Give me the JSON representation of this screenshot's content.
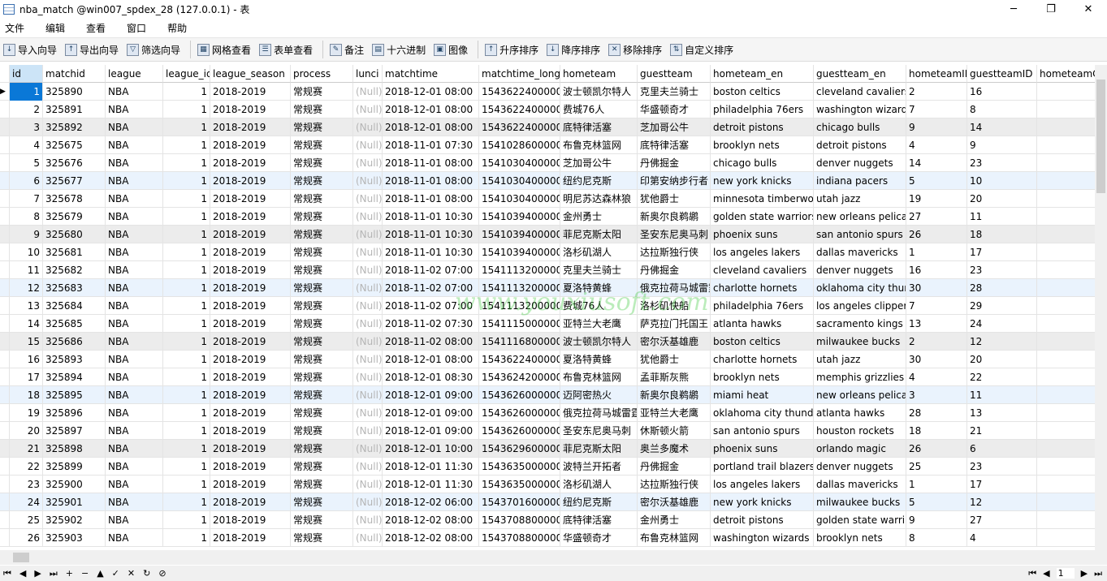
{
  "window": {
    "title": "nba_match @win007_spdex_28 (127.0.0.1) - 表",
    "minimize": "─",
    "restore": "❐",
    "close": "✕"
  },
  "menu": [
    "文件",
    "编辑",
    "查看",
    "窗口",
    "帮助"
  ],
  "toolbar": [
    {
      "label": "导入向导",
      "icon": "import-wizard-icon",
      "glyph": "↓"
    },
    {
      "label": "导出向导",
      "icon": "export-wizard-icon",
      "glyph": "↑"
    },
    {
      "label": "筛选向导",
      "icon": "filter-icon",
      "glyph": "▽"
    },
    {
      "label": "网格查看",
      "icon": "grid-view-icon",
      "glyph": "▦",
      "sep": true
    },
    {
      "label": "表单查看",
      "icon": "form-view-icon",
      "glyph": "☰"
    },
    {
      "label": "备注",
      "icon": "memo-icon",
      "glyph": "✎",
      "sep": true
    },
    {
      "label": "十六进制",
      "icon": "hex-icon",
      "glyph": "▤"
    },
    {
      "label": "图像",
      "icon": "image-icon",
      "glyph": "▣"
    },
    {
      "label": "升序排序",
      "icon": "sort-asc-icon",
      "glyph": "↑",
      "sep": true
    },
    {
      "label": "降序排序",
      "icon": "sort-desc-icon",
      "glyph": "↓"
    },
    {
      "label": "移除排序",
      "icon": "remove-sort-icon",
      "glyph": "✕"
    },
    {
      "label": "自定义排序",
      "icon": "custom-sort-icon",
      "glyph": "⇅"
    }
  ],
  "columns": [
    "id",
    "matchid",
    "league",
    "league_id",
    "league_season",
    "process",
    "lunci",
    "matchtime",
    "matchtime_long",
    "hometeam",
    "guestteam",
    "hometeam_en",
    "guestteam_en",
    "hometeamID",
    "guestteamID",
    "hometeamC"
  ],
  "null_text": "(Null)",
  "rows": [
    [
      "1",
      "325890",
      "NBA",
      "1",
      "2018-2019",
      "常规赛",
      "(Null)",
      "2018-12-01 08:00",
      "1543622400000",
      "波士顿凯尔特人",
      "克里夫兰骑士",
      "boston celtics",
      "cleveland cavaliers",
      "2",
      "16",
      ""
    ],
    [
      "2",
      "325891",
      "NBA",
      "1",
      "2018-2019",
      "常规赛",
      "(Null)",
      "2018-12-01 08:00",
      "1543622400000",
      "费城76人",
      "华盛顿奇才",
      "philadelphia 76ers",
      "washington wizard",
      "7",
      "8",
      ""
    ],
    [
      "3",
      "325892",
      "NBA",
      "1",
      "2018-2019",
      "常规赛",
      "(Null)",
      "2018-12-01 08:00",
      "1543622400000",
      "底特律活塞",
      "芝加哥公牛",
      "detroit pistons",
      "chicago bulls",
      "9",
      "14",
      ""
    ],
    [
      "4",
      "325675",
      "NBA",
      "1",
      "2018-2019",
      "常规赛",
      "(Null)",
      "2018-11-01 07:30",
      "1541028600000",
      "布鲁克林篮网",
      "底特律活塞",
      "brooklyn nets",
      "detroit pistons",
      "4",
      "9",
      ""
    ],
    [
      "5",
      "325676",
      "NBA",
      "1",
      "2018-2019",
      "常规赛",
      "(Null)",
      "2018-11-01 08:00",
      "1541030400000",
      "芝加哥公牛",
      "丹佛掘金",
      "chicago bulls",
      "denver nuggets",
      "14",
      "23",
      ""
    ],
    [
      "6",
      "325677",
      "NBA",
      "1",
      "2018-2019",
      "常规赛",
      "(Null)",
      "2018-11-01 08:00",
      "1541030400000",
      "纽约尼克斯",
      "印第安纳步行者",
      "new york knicks",
      "indiana pacers",
      "5",
      "10",
      ""
    ],
    [
      "7",
      "325678",
      "NBA",
      "1",
      "2018-2019",
      "常规赛",
      "(Null)",
      "2018-11-01 08:00",
      "1541030400000",
      "明尼苏达森林狼",
      "犹他爵士",
      "minnesota timberwol",
      "utah jazz",
      "19",
      "20",
      ""
    ],
    [
      "8",
      "325679",
      "NBA",
      "1",
      "2018-2019",
      "常规赛",
      "(Null)",
      "2018-11-01 10:30",
      "1541039400000",
      "金州勇士",
      "新奥尔良鹈鹕",
      "golden state warriors",
      "new orleans pelica",
      "27",
      "11",
      ""
    ],
    [
      "9",
      "325680",
      "NBA",
      "1",
      "2018-2019",
      "常规赛",
      "(Null)",
      "2018-11-01 10:30",
      "1541039400000",
      "菲尼克斯太阳",
      "圣安东尼奥马刺",
      "phoenix suns",
      "san antonio spurs",
      "26",
      "18",
      ""
    ],
    [
      "10",
      "325681",
      "NBA",
      "1",
      "2018-2019",
      "常规赛",
      "(Null)",
      "2018-11-01 10:30",
      "1541039400000",
      "洛杉矶湖人",
      "达拉斯独行侠",
      "los angeles lakers",
      "dallas mavericks",
      "1",
      "17",
      ""
    ],
    [
      "11",
      "325682",
      "NBA",
      "1",
      "2018-2019",
      "常规赛",
      "(Null)",
      "2018-11-02 07:00",
      "1541113200000",
      "克里夫兰骑士",
      "丹佛掘金",
      "cleveland cavaliers",
      "denver nuggets",
      "16",
      "23",
      ""
    ],
    [
      "12",
      "325683",
      "NBA",
      "1",
      "2018-2019",
      "常规赛",
      "(Null)",
      "2018-11-02 07:00",
      "1541113200000",
      "夏洛特黄蜂",
      "俄克拉荷马城雷霆",
      "charlotte hornets",
      "oklahoma city thur",
      "30",
      "28",
      ""
    ],
    [
      "13",
      "325684",
      "NBA",
      "1",
      "2018-2019",
      "常规赛",
      "(Null)",
      "2018-11-02 07:00",
      "1541113200000",
      "费城76人",
      "洛杉矶快船",
      "philadelphia 76ers",
      "los angeles clipper",
      "7",
      "29",
      ""
    ],
    [
      "14",
      "325685",
      "NBA",
      "1",
      "2018-2019",
      "常规赛",
      "(Null)",
      "2018-11-02 07:30",
      "1541115000000",
      "亚特兰大老鹰",
      "萨克拉门托国王",
      "atlanta hawks",
      "sacramento kings",
      "13",
      "24",
      ""
    ],
    [
      "15",
      "325686",
      "NBA",
      "1",
      "2018-2019",
      "常规赛",
      "(Null)",
      "2018-11-02 08:00",
      "1541116800000",
      "波士顿凯尔特人",
      "密尔沃基雄鹿",
      "boston celtics",
      "milwaukee bucks",
      "2",
      "12",
      ""
    ],
    [
      "16",
      "325893",
      "NBA",
      "1",
      "2018-2019",
      "常规赛",
      "(Null)",
      "2018-12-01 08:00",
      "1543622400000",
      "夏洛特黄蜂",
      "犹他爵士",
      "charlotte hornets",
      "utah jazz",
      "30",
      "20",
      ""
    ],
    [
      "17",
      "325894",
      "NBA",
      "1",
      "2018-2019",
      "常规赛",
      "(Null)",
      "2018-12-01 08:30",
      "1543624200000",
      "布鲁克林篮网",
      "孟菲斯灰熊",
      "brooklyn nets",
      "memphis grizzlies",
      "4",
      "22",
      ""
    ],
    [
      "18",
      "325895",
      "NBA",
      "1",
      "2018-2019",
      "常规赛",
      "(Null)",
      "2018-12-01 09:00",
      "1543626000000",
      "迈阿密热火",
      "新奥尔良鹈鹕",
      "miami heat",
      "new orleans pelica",
      "3",
      "11",
      ""
    ],
    [
      "19",
      "325896",
      "NBA",
      "1",
      "2018-2019",
      "常规赛",
      "(Null)",
      "2018-12-01 09:00",
      "1543626000000",
      "俄克拉荷马城雷霆",
      "亚特兰大老鹰",
      "oklahoma city thunde",
      "atlanta hawks",
      "28",
      "13",
      ""
    ],
    [
      "20",
      "325897",
      "NBA",
      "1",
      "2018-2019",
      "常规赛",
      "(Null)",
      "2018-12-01 09:00",
      "1543626000000",
      "圣安东尼奥马刺",
      "休斯顿火箭",
      "san antonio spurs",
      "houston rockets",
      "18",
      "21",
      ""
    ],
    [
      "21",
      "325898",
      "NBA",
      "1",
      "2018-2019",
      "常规赛",
      "(Null)",
      "2018-12-01 10:00",
      "1543629600000",
      "菲尼克斯太阳",
      "奥兰多魔术",
      "phoenix suns",
      "orlando magic",
      "26",
      "6",
      ""
    ],
    [
      "22",
      "325899",
      "NBA",
      "1",
      "2018-2019",
      "常规赛",
      "(Null)",
      "2018-12-01 11:30",
      "1543635000000",
      "波特兰开拓者",
      "丹佛掘金",
      "portland trail blazers",
      "denver nuggets",
      "25",
      "23",
      ""
    ],
    [
      "23",
      "325900",
      "NBA",
      "1",
      "2018-2019",
      "常规赛",
      "(Null)",
      "2018-12-01 11:30",
      "1543635000000",
      "洛杉矶湖人",
      "达拉斯独行侠",
      "los angeles lakers",
      "dallas mavericks",
      "1",
      "17",
      ""
    ],
    [
      "24",
      "325901",
      "NBA",
      "1",
      "2018-2019",
      "常规赛",
      "(Null)",
      "2018-12-02 06:00",
      "1543701600000",
      "纽约尼克斯",
      "密尔沃基雄鹿",
      "new york knicks",
      "milwaukee bucks",
      "5",
      "12",
      ""
    ],
    [
      "25",
      "325902",
      "NBA",
      "1",
      "2018-2019",
      "常规赛",
      "(Null)",
      "2018-12-02 08:00",
      "1543708800000",
      "底特律活塞",
      "金州勇士",
      "detroit pistons",
      "golden state warri",
      "9",
      "27",
      ""
    ],
    [
      "26",
      "325903",
      "NBA",
      "1",
      "2018-2019",
      "常规赛",
      "(Null)",
      "2018-12-02 08:00",
      "1543708800000",
      "华盛顿奇才",
      "布鲁克林篮网",
      "washington wizards",
      "brooklyn nets",
      "8",
      "4",
      ""
    ]
  ],
  "selected_row": 1,
  "status_controls": [
    "⏮",
    "◀",
    "▶",
    "⏭",
    "+",
    "−",
    "▲",
    "✓",
    "✕",
    "↻",
    "⊘"
  ],
  "pager": {
    "first": "⏮",
    "prev": "◀",
    "page": "1",
    "next": "▶",
    "last": "⏭"
  },
  "watermark": "www.youxiusoft.com",
  "colors": {
    "selected": "#0a78d7",
    "row_gray": "#ececec",
    "row_blue": "#eaf3fd"
  }
}
